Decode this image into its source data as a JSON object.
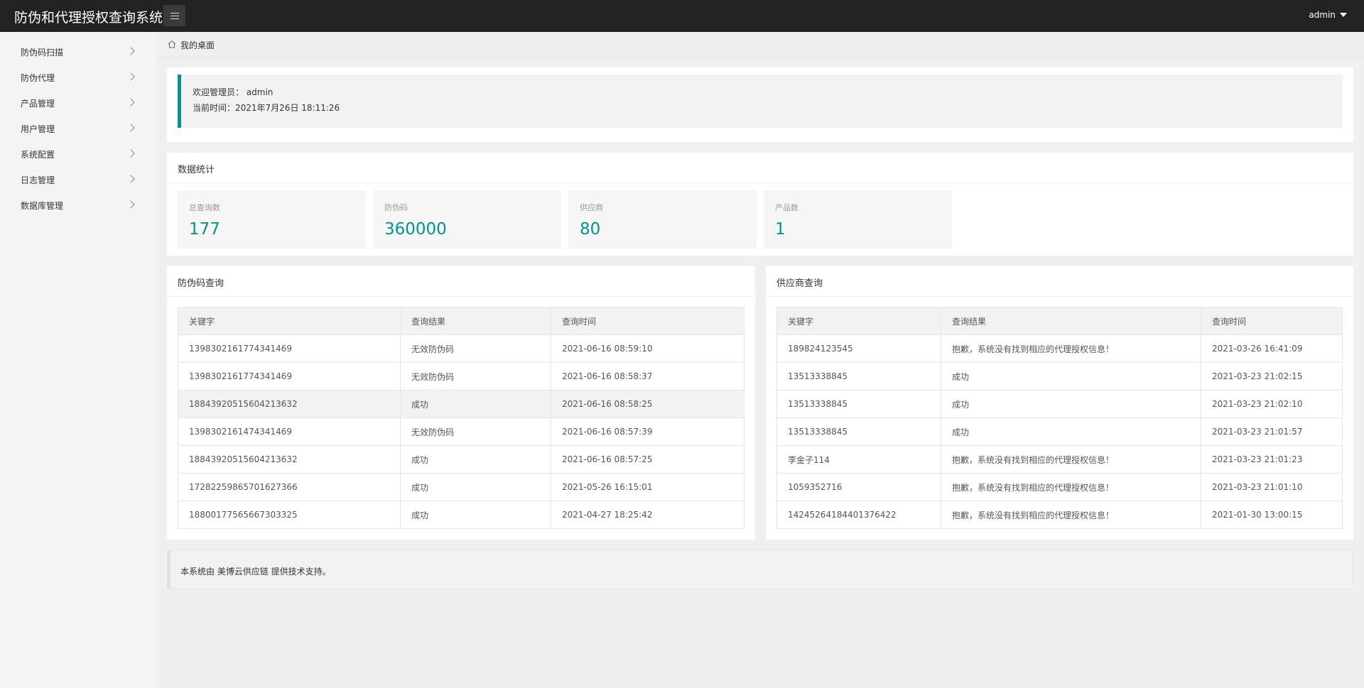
{
  "app": {
    "title": "防伪和代理授权查询系统",
    "user": "admin"
  },
  "sidebar": {
    "items": [
      {
        "label": "防伪码扫描"
      },
      {
        "label": "防伪代理"
      },
      {
        "label": "产品管理"
      },
      {
        "label": "用户管理"
      },
      {
        "label": "系统配置"
      },
      {
        "label": "日志管理"
      },
      {
        "label": "数据库管理"
      }
    ]
  },
  "breadcrumb": {
    "label": "我的桌面"
  },
  "welcome": {
    "admin_line": "欢迎管理员：  admin",
    "time_line": "当前时间：2021年7月26日 18:11:26"
  },
  "stats": {
    "title": "数据统计",
    "tiles": [
      {
        "label": "总查询数",
        "value": "177"
      },
      {
        "label": "防伪码",
        "value": "360000"
      },
      {
        "label": "供应商",
        "value": "80"
      },
      {
        "label": "产品数",
        "value": "1"
      }
    ]
  },
  "code_query": {
    "title": "防伪码查询",
    "columns": [
      "关键字",
      "查询结果",
      "查询时间"
    ],
    "rows": [
      [
        "1398302161774341469",
        "无效防伪码",
        "2021-06-16 08:59:10"
      ],
      [
        "1398302161774341469",
        "无效防伪码",
        "2021-06-16 08:58:37"
      ],
      [
        "1884392051560421363​2",
        "成功",
        "2021-06-16 08:58:25"
      ],
      [
        "1398302161474341469",
        "无效防伪码",
        "2021-06-16 08:57:39"
      ],
      [
        "18843920515604213632",
        "成功",
        "2021-06-16 08:57:25"
      ],
      [
        "17282259865701627366",
        "成功",
        "2021-05-26 16:15:01"
      ],
      [
        "18800177565667303325",
        "成功",
        "2021-04-27 18:25:42"
      ]
    ]
  },
  "supplier_query": {
    "title": "供应商查询",
    "columns": [
      "关键字",
      "查询结果",
      "查询时间"
    ],
    "rows": [
      [
        "189824123545",
        "抱歉，系统没有找到相应的代理授权信息！",
        "2021-03-26 16:41:09"
      ],
      [
        "13513338845",
        "成功",
        "2021-03-23 21:02:15"
      ],
      [
        "13513338845",
        "成功",
        "2021-03-23 21:02:10"
      ],
      [
        "13513338845",
        "成功",
        "2021-03-23 21:01:57"
      ],
      [
        "李金子114",
        "抱歉，系统没有找到相应的代理授权信息！",
        "2021-03-23 21:01:23"
      ],
      [
        "1059352716",
        "抱歉，系统没有找到相应的代理授权信息！",
        "2021-03-23 21:01:10"
      ],
      [
        "14245264184401376422",
        "抱歉，系统没有找到相应的代理授权信息！",
        "2021-01-30 13:00:15"
      ]
    ]
  },
  "footer": {
    "text": "本系统由  美博云供应链 提供技术支持。"
  },
  "colors": {
    "accent": "#009688",
    "topbar": "#222222"
  },
  "icons": {
    "menu": "menu-toggle-icon",
    "home": "home-icon",
    "chevron": "chevron-right-icon",
    "caret": "caret-down-icon"
  }
}
